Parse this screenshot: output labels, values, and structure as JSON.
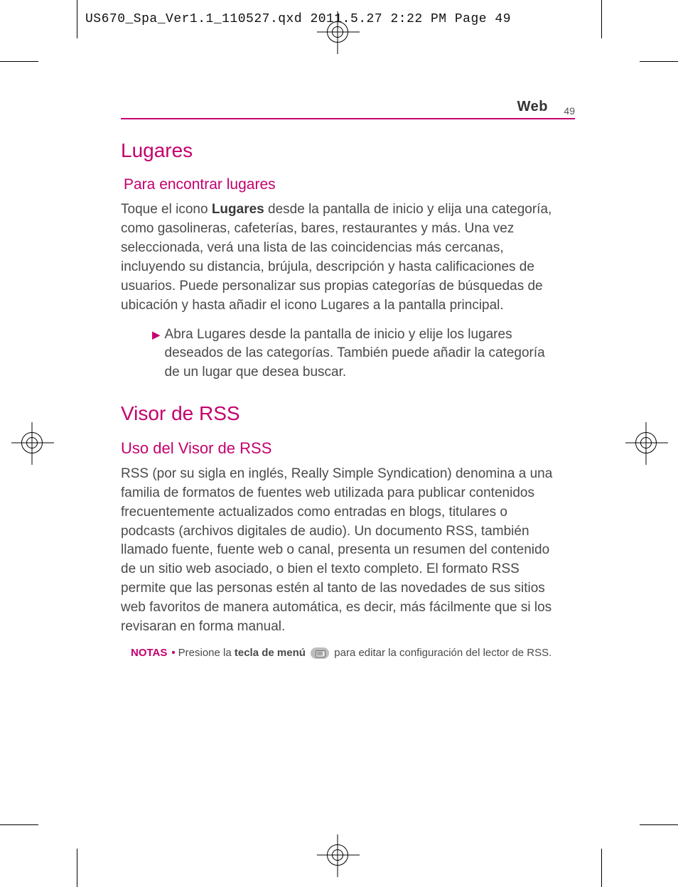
{
  "meta": {
    "qxd_line": "US670_Spa_Ver1.1_110527.qxd  2011.5.27  2:22 PM  Page 49"
  },
  "runhead": {
    "title": "Web",
    "page": "49"
  },
  "lugares": {
    "h1": "Lugares",
    "h2": "Para encontrar lugares",
    "p_pre": "Toque el icono ",
    "p_bold": "Lugares",
    "p_post": " desde la pantalla de inicio y elija una categoría, como gasolineras, cafeterías, bares, restaurantes y más. Una vez seleccionada, verá una lista de las coincidencias más cercanas, incluyendo su distancia, brújula, descripción y hasta calificaciones de usuarios. Puede personalizar sus propias categorías de búsquedas de ubicación y hasta añadir el icono Lugares a la pantalla principal.",
    "bullet_mark": "▶",
    "bullet": "Abra Lugares desde la pantalla de inicio y elije los lugares deseados de las categorías. También puede añadir la categoría de un lugar que desea buscar."
  },
  "rss": {
    "h1": "Visor de RSS",
    "h2": "Uso del Visor de RSS",
    "p": "RSS (por su sigla en inglés, Really Simple Syndication) denomina a una familia de formatos de fuentes web utilizada para publicar contenidos frecuentemente actualizados como entradas en blogs, titulares o podcasts (archivos digitales de audio). Un documento RSS, también llamado fuente, fuente web o canal, presenta un resumen del contenido de un sitio web asociado, o bien el texto completo. El formato RSS permite que las personas estén al tanto de las novedades de sus sitios web favoritos de manera automática, es decir, más fácilmente que si los revisaran en forma manual.",
    "note_label": "NOTAS",
    "note_bullet": "•",
    "note_pre": "Presione la ",
    "note_bold": "tecla de menú",
    "note_post": " para editar la configuración del lector de RSS."
  }
}
